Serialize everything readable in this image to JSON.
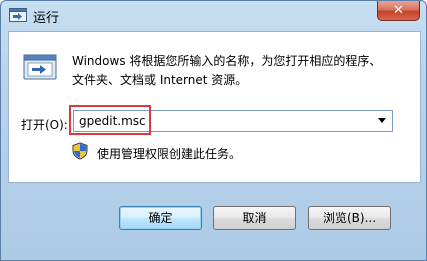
{
  "window": {
    "title": "运行",
    "close_label": "✕"
  },
  "dialog": {
    "description_line1": "Windows 将根据您所输入的名称，为您打开相应的程序、",
    "description_line2": "文件夹、文档或 Internet 资源。",
    "open_label": "打开(O):",
    "open_value": "gpedit.msc",
    "admin_note": "使用管理权限创建此任务。"
  },
  "buttons": {
    "ok": "确定",
    "cancel": "取消",
    "browse": "浏览(B)..."
  },
  "colors": {
    "highlight_box": "#d93a3a",
    "close_button": "#c5422a",
    "frame": "#aecbe6"
  },
  "icons": {
    "title": "run-app-icon",
    "dialog": "run-window-icon",
    "admin": "uac-shield-icon",
    "dropdown": "chevron-down-icon"
  }
}
